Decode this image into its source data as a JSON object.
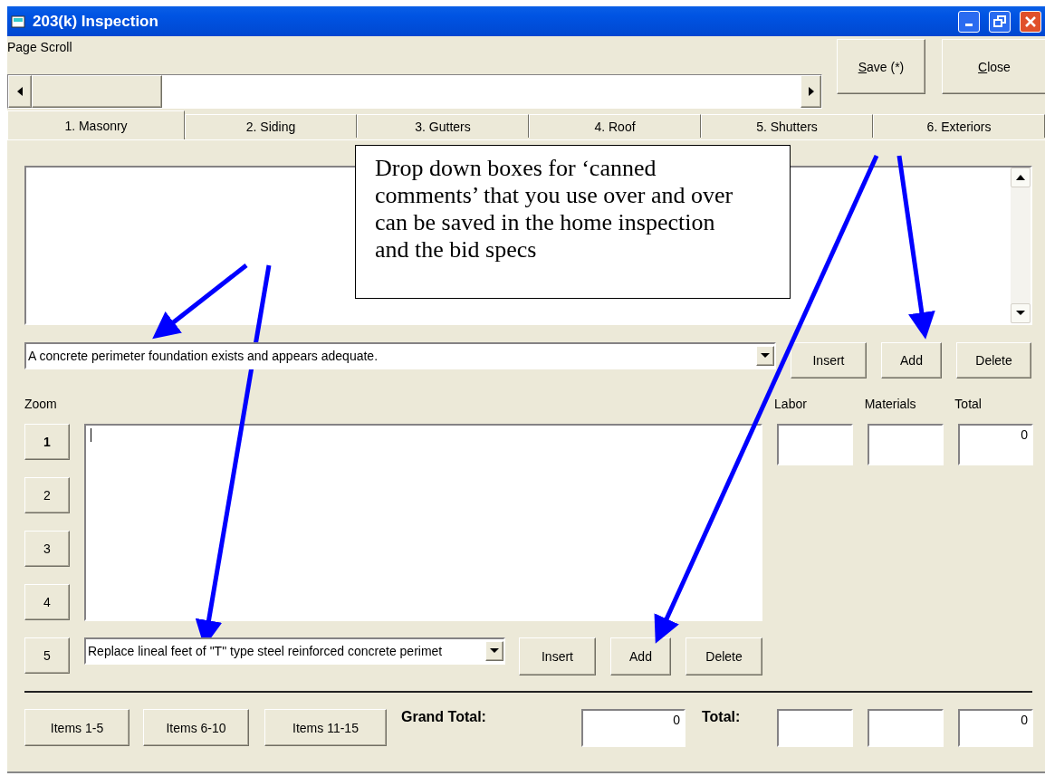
{
  "window": {
    "title": "203(k) Inspection"
  },
  "page_scroll": {
    "label": "Page Scroll"
  },
  "header_buttons": [
    {
      "label": "Save (*)",
      "mnemonic_underlined": true
    },
    {
      "label": "Close",
      "mnemonic_underlined": true
    }
  ],
  "tabs": [
    {
      "label": "1. Masonry",
      "selected": true
    },
    {
      "label": "2. Siding",
      "selected": false
    },
    {
      "label": "3. Gutters",
      "selected": false
    },
    {
      "label": "4. Roof",
      "selected": false
    },
    {
      "label": "5. Shutters",
      "selected": false
    },
    {
      "label": "6. Exteriors",
      "selected": false
    }
  ],
  "comment_dropdown": {
    "value": "A concrete perimeter foundation exists and appears adequate."
  },
  "comment_buttons": [
    "Insert",
    "Add",
    "Delete"
  ],
  "zoom_label": "Zoom",
  "cost_headers": [
    "Labor",
    "Materials",
    "Total"
  ],
  "cost_values": {
    "total": "0"
  },
  "zoom_buttons": [
    {
      "label": "1",
      "selected": true
    },
    {
      "label": "2",
      "selected": false
    },
    {
      "label": "3",
      "selected": false
    },
    {
      "label": "4",
      "selected": false
    },
    {
      "label": "5",
      "selected": false
    }
  ],
  "spec_dropdown": {
    "value": "Replace lineal feet of \"T\" type steel reinforced concrete perimet"
  },
  "spec_buttons": [
    "Insert",
    "Add",
    "Delete"
  ],
  "footer": {
    "item_buttons": [
      "Items 1-5",
      "Items 6-10",
      "Items 11-15"
    ],
    "grand_total_label": "Grand Total:",
    "grand_total_value": "0",
    "total_label": "Total:",
    "total_value": "0"
  },
  "annotation": {
    "text": "Drop down boxes for ‘canned comments’ that you use over and over can be saved in the home inspection and the bid specs"
  }
}
